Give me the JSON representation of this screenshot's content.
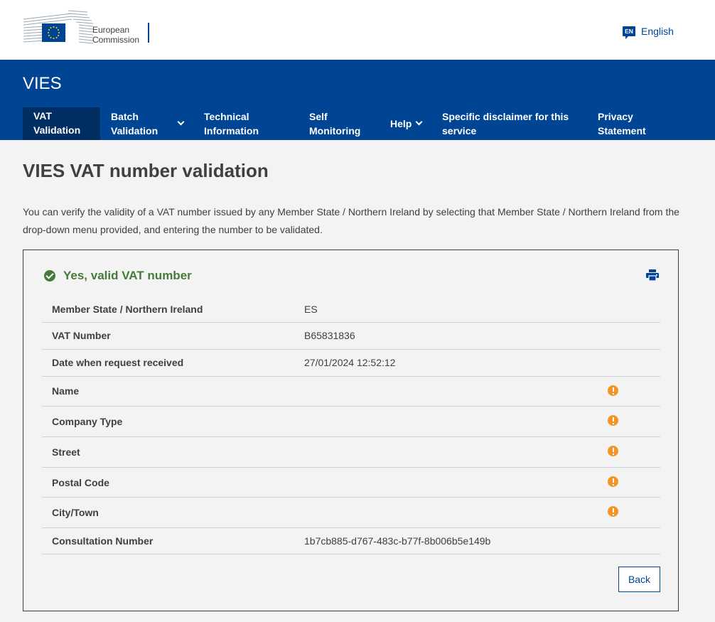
{
  "header": {
    "logo_line1": "European",
    "logo_line2": "Commission",
    "language": {
      "code": "EN",
      "label": "English"
    }
  },
  "site": {
    "title": "VIES"
  },
  "nav": {
    "items": [
      {
        "line1": "VAT",
        "line2": "Validation",
        "active": true
      },
      {
        "line1": "Batch",
        "line2": "Validation",
        "has_dropdown": true
      },
      {
        "line1": "Technical",
        "line2": "Information"
      },
      {
        "line1": "Self",
        "line2": "Monitoring"
      },
      {
        "line1": "Help",
        "has_dropdown": true
      },
      {
        "line1": "Specific disclaimer for this",
        "line2": "service"
      },
      {
        "line1": "Privacy",
        "line2": "Statement"
      }
    ]
  },
  "main": {
    "title": "VIES VAT number validation",
    "intro": "You can verify the validity of a VAT number issued by any Member State / Northern Ireland by selecting that Member State / Northern Ireland from the drop-down menu provided, and entering the number to be validated."
  },
  "result": {
    "status": "Yes, valid VAT number",
    "rows": [
      {
        "label": "Member State / Northern Ireland",
        "value": "ES"
      },
      {
        "label": "VAT Number",
        "value": "B65831836"
      },
      {
        "label": "Date when request received",
        "value": "27/01/2024 12:52:12"
      },
      {
        "label": "Name",
        "value": "",
        "warning": true
      },
      {
        "label": "Company Type",
        "value": "",
        "warning": true
      },
      {
        "label": "Street",
        "value": "",
        "warning": true
      },
      {
        "label": "Postal Code",
        "value": "",
        "warning": true
      },
      {
        "label": "City/Town",
        "value": "",
        "warning": true
      },
      {
        "label": "Consultation Number",
        "value": "1b7cb885-d767-483c-b77f-8b006b5e149b"
      }
    ],
    "back_label": "Back"
  },
  "colors": {
    "brand_blue": "#004494",
    "nav_active": "#002d62",
    "success_green": "#467a39",
    "warning_orange": "#f29527"
  },
  "icons": {
    "language": "language-icon",
    "status": "check-circle-icon",
    "print": "printer-icon",
    "warning": "warning-icon",
    "dropdown": "chevron-down-icon"
  }
}
